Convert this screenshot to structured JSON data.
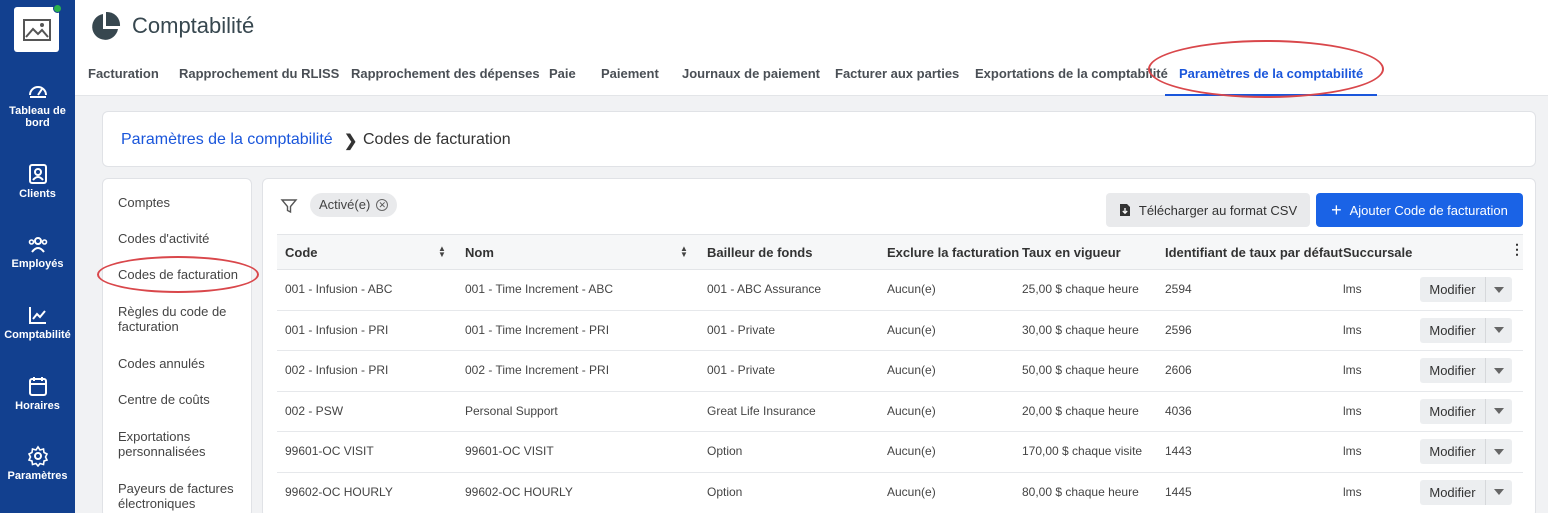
{
  "rail": {
    "items": [
      {
        "label": "Tableau de bord",
        "icon": "gauge-icon"
      },
      {
        "label": "Clients",
        "icon": "person-card-icon"
      },
      {
        "label": "Employés",
        "icon": "people-icon"
      },
      {
        "label": "Comptabilité",
        "icon": "chart-line-icon"
      },
      {
        "label": "Horaires",
        "icon": "calendar-icon"
      },
      {
        "label": "Paramètres",
        "icon": "gear-icon"
      }
    ]
  },
  "header": {
    "title": "Comptabilité",
    "tabs": [
      {
        "label": "Facturation"
      },
      {
        "label": "Rapprochement du RLISS"
      },
      {
        "label": "Rapprochement des dépenses"
      },
      {
        "label": "Paie"
      },
      {
        "label": "Paiement"
      },
      {
        "label": "Journaux de paiement"
      },
      {
        "label": "Facturer aux parties"
      },
      {
        "label": "Exportations de la comptabilité"
      },
      {
        "label": "Paramètres de la comptabilité"
      }
    ],
    "active_tab": "Paramètres de la comptabilité"
  },
  "breadcrumb": {
    "parent": "Paramètres de la comptabilité",
    "current": "Codes de facturation"
  },
  "side_menu": {
    "items": [
      {
        "label": "Comptes"
      },
      {
        "label": "Codes d'activité"
      },
      {
        "label": "Codes de facturation"
      },
      {
        "label": "Règles du code de facturation"
      },
      {
        "label": "Codes annulés"
      },
      {
        "label": "Centre de coûts"
      },
      {
        "label": "Exportations personnalisées"
      },
      {
        "label": "Payeurs de factures électroniques"
      }
    ],
    "active": "Codes de facturation"
  },
  "toolbar": {
    "filter_chip": "Activé(e)",
    "csv_label": "Télécharger au format CSV",
    "add_label": "Ajouter Code de facturation"
  },
  "table": {
    "headers": [
      "Code",
      "Nom",
      "Bailleur de fonds",
      "Exclure la facturation",
      "Taux en vigueur",
      "Identifiant de taux par défaut",
      "Succursale"
    ],
    "rows": [
      [
        "001 - Infusion - ABC",
        "001 - Time Increment - ABC",
        "001 - ABC Assurance",
        "Aucun(e)",
        "25,00 $ chaque heure",
        "2594",
        "lms"
      ],
      [
        "001 - Infusion - PRI",
        "001 - Time Increment - PRI",
        "001 - Private",
        "Aucun(e)",
        "30,00 $ chaque heure",
        "2596",
        "lms"
      ],
      [
        "002 - Infusion - PRI",
        "002 - Time Increment - PRI",
        "001 - Private",
        "Aucun(e)",
        "50,00 $ chaque heure",
        "2606",
        "lms"
      ],
      [
        "002 - PSW",
        "Personal Support",
        "Great Life Insurance",
        "Aucun(e)",
        "20,00 $ chaque heure",
        "4036",
        "lms"
      ],
      [
        "99601-OC VISIT",
        "99601-OC VISIT",
        "Option",
        "Aucun(e)",
        "170,00 $ chaque visite",
        "1443",
        "lms"
      ],
      [
        "99602-OC HOURLY",
        "99602-OC HOURLY",
        "Option",
        "Aucun(e)",
        "80,00 $ chaque heure",
        "1445",
        "lms"
      ]
    ],
    "row_action": "Modifier"
  },
  "colors": {
    "rail": "#12408f",
    "accent": "#1a56db",
    "primary_button": "#1a63e6",
    "annotation": "#d9474b"
  }
}
